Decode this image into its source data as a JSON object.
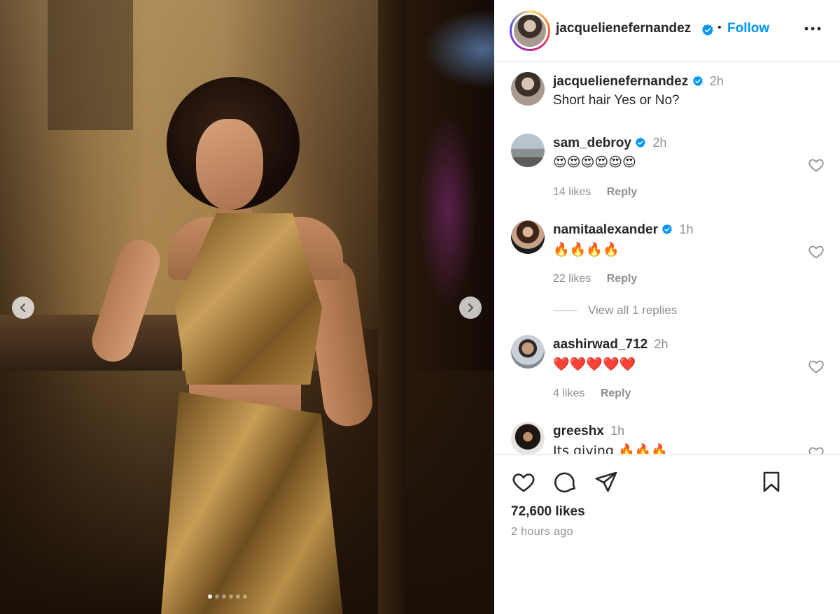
{
  "post": {
    "author": "jacquelienefernandez",
    "follow_label": "Follow",
    "separator": "•",
    "likes": "72,600 likes",
    "posted": "2 hours ago",
    "carousel": {
      "current_slide": 1,
      "total_slides": 6
    }
  },
  "caption": {
    "name": "jacquelienefernandez",
    "time": "2h",
    "text": "Short hair Yes or No?"
  },
  "comments": [
    {
      "name": "sam_debroy",
      "verified": true,
      "time": "2h",
      "text": "😍😍😍😍😍😍",
      "likes": "14 likes",
      "reply": "Reply"
    },
    {
      "name": "namitaalexander",
      "verified": true,
      "time": "1h",
      "text": "🔥🔥🔥🔥",
      "likes": "22 likes",
      "reply": "Reply"
    },
    {
      "name": "aashirwad_712",
      "verified": false,
      "time": "2h",
      "text": "❤️❤️❤️❤️❤️",
      "likes": "4 likes",
      "reply": "Reply"
    },
    {
      "name": "greeshx",
      "verified": false,
      "time": "1h",
      "text": "Its giving 🔥🔥🔥",
      "likes": "",
      "reply": ""
    }
  ],
  "view_replies": "View all 1 replies",
  "colors": {
    "follow": "#0095f6",
    "verified": "#0095f6",
    "muted": "#8e8e8e",
    "text": "#262626"
  },
  "icons": {
    "prev": "chevron-left-icon",
    "next": "chevron-right-icon",
    "more": "more-horizontal-icon",
    "like": "heart-icon",
    "comment": "comment-icon",
    "share": "send-icon",
    "save": "bookmark-icon"
  }
}
